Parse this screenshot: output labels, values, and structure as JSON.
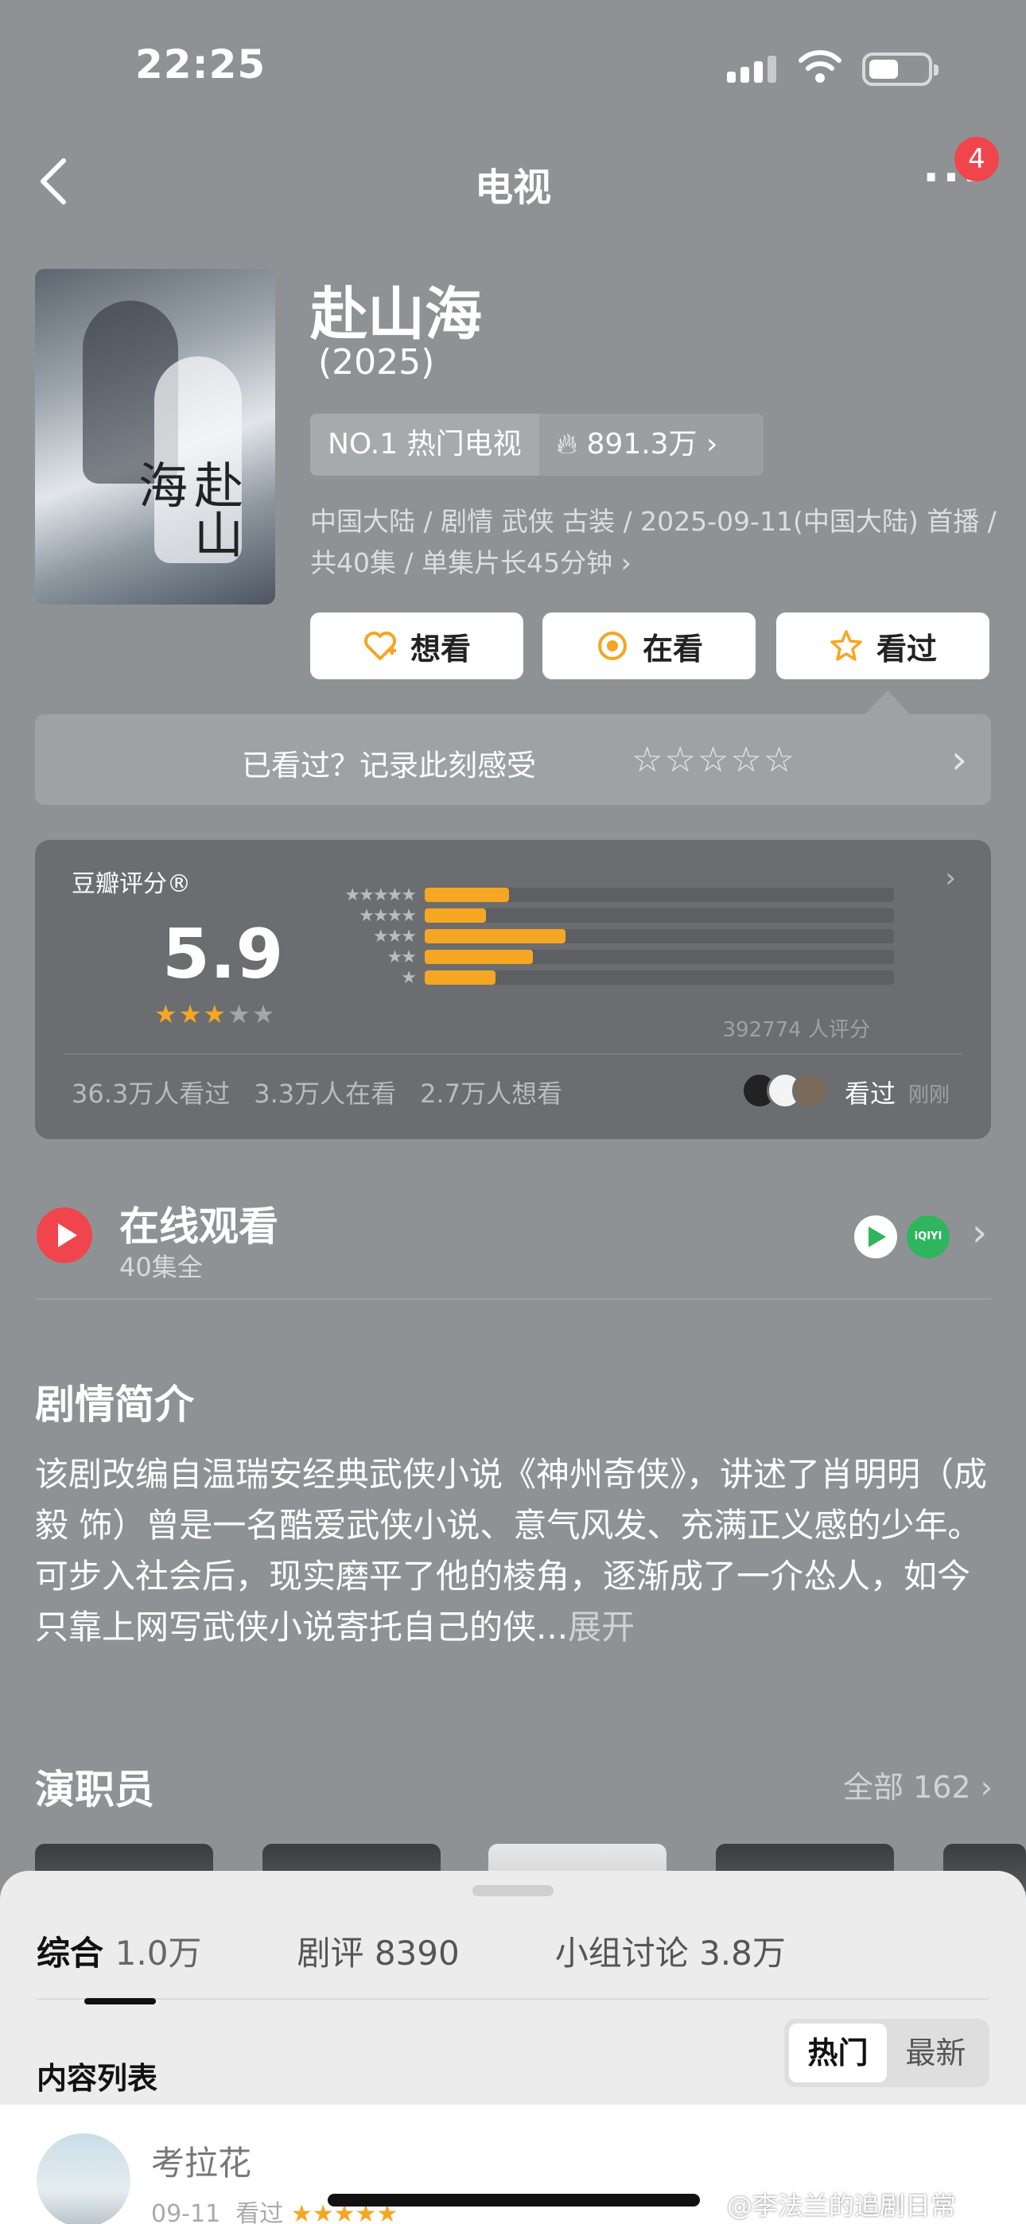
{
  "status": {
    "time": "22:25"
  },
  "nav": {
    "title": "电视",
    "badge": "4"
  },
  "movie": {
    "title": "赴山海",
    "year": "(2025)",
    "rank": "NO.1 热门电视",
    "heat": "891.3万",
    "meta_line1": "中国大陆 / 剧情 武侠 古装 / 2025-09-11(中国大陆) 首播 /",
    "meta_line2": "共40集 / 单集片长45分钟",
    "poster_text": "赴山海"
  },
  "actions": {
    "want": "想看",
    "watching": "在看",
    "watched": "看过"
  },
  "watched_prompt": {
    "text": "已看过？记录此刻感受",
    "stars": "☆☆☆☆☆"
  },
  "rating": {
    "label": "豆瓣评分®",
    "score": "5.9",
    "stars_on": "★★★",
    "stars_off": "★★",
    "distribution": [
      {
        "label": "★★★★★",
        "fraction": 0.18
      },
      {
        "label": "★★★★",
        "fraction": 0.13
      },
      {
        "label": "★★★",
        "fraction": 0.3
      },
      {
        "label": "★★",
        "fraction": 0.23
      },
      {
        "label": "★",
        "fraction": 0.15
      }
    ],
    "count": "392774 人评分",
    "watched_count": "36.3万人看过",
    "watching_count": "3.3万人在看",
    "want_count": "2.7万人想看",
    "friends_seen": "看过",
    "friends_time": "刚刚"
  },
  "online": {
    "title": "在线观看",
    "sub": "40集全",
    "platform2": "iQIYI 爱奇艺"
  },
  "synopsis": {
    "title": "剧情简介",
    "text": "该剧改编自温瑞安经典武侠小说《神州奇侠》，讲述了肖明明（成毅 饰）曾是一名酷爱武侠小说、意气风发、充满正义感的少年。可步入社会后，现实磨平了他的棱角，逐渐成了一介怂人，如今只靠上网写武侠小说寄托自己的侠...",
    "more": "展开"
  },
  "cast": {
    "title": "演职员",
    "all": "全部 162 ›"
  },
  "sheet": {
    "tabs": [
      {
        "label": "综合",
        "num": "1.0万"
      },
      {
        "label": "剧评",
        "num": "8390"
      },
      {
        "label": "小组讨论",
        "num": "3.8万"
      }
    ],
    "list_title": "内容列表",
    "seg_hot": "热门",
    "seg_new": "最新",
    "post_name": "考拉花",
    "post_date": "09-11",
    "post_action": "看过",
    "post_stars": "★★★★★"
  },
  "watermark": "@李法兰的追剧日常",
  "colors": {
    "accent": "#f5a623",
    "red": "#f0454c",
    "green": "#2fb55e"
  }
}
